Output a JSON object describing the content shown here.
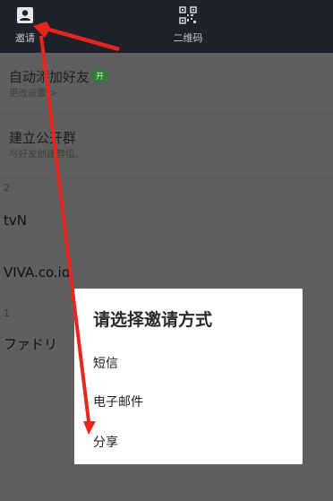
{
  "tabs": {
    "invite_label": "邀请",
    "qr_label": "二维码"
  },
  "settings": {
    "auto_add_title": "自动添加好友",
    "auto_add_badge": "开",
    "auto_add_sub": "更改设置 >",
    "open_group_title": "建立公开群",
    "open_group_sub": "与好友创建群组。"
  },
  "sections": [
    {
      "count": "2",
      "friends": [
        "tvN",
        "VIVA.co.id"
      ]
    },
    {
      "count": "1",
      "friends": [
        "ファドリ"
      ]
    }
  ],
  "dialog": {
    "title": "请选择邀请方式",
    "options": [
      "短信",
      "电子邮件",
      "分享"
    ]
  },
  "colors": {
    "annotation_arrow": "#e8261e",
    "topbar": "#1f222b",
    "badge": "#2e7d32"
  }
}
